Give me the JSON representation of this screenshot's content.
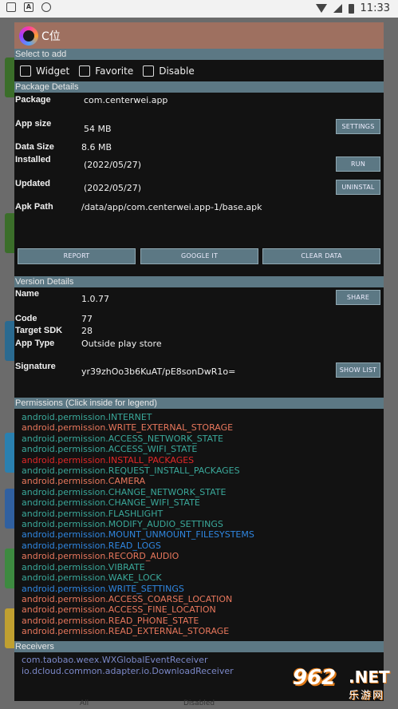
{
  "status_bar": {
    "time": "11:33"
  },
  "dialog": {
    "title": "C位"
  },
  "select_to_add": {
    "header": "Select to add",
    "options": [
      {
        "label": "Widget",
        "checked": false
      },
      {
        "label": "Favorite",
        "checked": false
      },
      {
        "label": "Disable",
        "checked": false
      }
    ]
  },
  "package_details": {
    "header": "Package Details",
    "package_label": "Package",
    "package_value": "com.centerwei.app",
    "app_size_label": "App size",
    "app_size_value": "54 MB",
    "data_size_label": "Data Size",
    "data_size_value": "8.6 MB",
    "installed_label": "Installed",
    "installed_value": "(2022/05/27)",
    "updated_label": "Updated",
    "updated_value": "(2022/05/27)",
    "apk_path_label": "Apk Path",
    "apk_path_value": "/data/app/com.centerwei.app-1/base.apk",
    "buttons": {
      "settings": "SETTINGS",
      "run": "RUN",
      "uninstal": "UNINSTAL",
      "report": "REPORT",
      "google_it": "GOOGLE IT",
      "clear_data": "CLEAR DATA"
    }
  },
  "version_details": {
    "header": "Version Details",
    "name_label": "Name",
    "name_value": "1.0.77",
    "code_label": "Code",
    "code_value": "77",
    "target_sdk_label": "Target SDK",
    "target_sdk_value": "28",
    "app_type_label": "App Type",
    "app_type_value": "Outside play store",
    "signature_label": "Signature",
    "signature_value": "yr39zhOo3b6KuAT/pE8sonDwR1o=",
    "buttons": {
      "share": "SHARE",
      "show_list": "SHOW LIST"
    }
  },
  "permissions": {
    "header": "Permissions (Click inside for legend)",
    "colors": {
      "teal": "#3aa89a",
      "salmon": "#e8775c",
      "red": "#e02828",
      "blue": "#2f86e0"
    },
    "items": [
      {
        "name": "android.permission.INTERNET",
        "color": "#3aa89a"
      },
      {
        "name": "android.permission.WRITE_EXTERNAL_STORAGE",
        "color": "#e8775c"
      },
      {
        "name": "android.permission.ACCESS_NETWORK_STATE",
        "color": "#3aa89a"
      },
      {
        "name": "android.permission.ACCESS_WIFI_STATE",
        "color": "#3aa89a"
      },
      {
        "name": "android.permission.INSTALL_PACKAGES",
        "color": "#e02828"
      },
      {
        "name": "android.permission.REQUEST_INSTALL_PACKAGES",
        "color": "#3aa89a"
      },
      {
        "name": "android.permission.CAMERA",
        "color": "#e8775c"
      },
      {
        "name": "android.permission.CHANGE_NETWORK_STATE",
        "color": "#3aa89a"
      },
      {
        "name": "android.permission.CHANGE_WIFI_STATE",
        "color": "#3aa89a"
      },
      {
        "name": "android.permission.FLASHLIGHT",
        "color": "#3aa89a"
      },
      {
        "name": "android.permission.MODIFY_AUDIO_SETTINGS",
        "color": "#3aa89a"
      },
      {
        "name": "android.permission.MOUNT_UNMOUNT_FILESYSTEMS",
        "color": "#2f86e0"
      },
      {
        "name": "android.permission.READ_LOGS",
        "color": "#2f86e0"
      },
      {
        "name": "android.permission.RECORD_AUDIO",
        "color": "#e8775c"
      },
      {
        "name": "android.permission.VIBRATE",
        "color": "#3aa89a"
      },
      {
        "name": "android.permission.WAKE_LOCK",
        "color": "#3aa89a"
      },
      {
        "name": "android.permission.WRITE_SETTINGS",
        "color": "#2f86e0"
      },
      {
        "name": "android.permission.ACCESS_COARSE_LOCATION",
        "color": "#e8775c"
      },
      {
        "name": "android.permission.ACCESS_FINE_LOCATION",
        "color": "#e8775c"
      },
      {
        "name": "android.permission.READ_PHONE_STATE",
        "color": "#e8775c"
      },
      {
        "name": "android.permission.READ_EXTERNAL_STORAGE",
        "color": "#e8775c"
      }
    ]
  },
  "receivers": {
    "header": "Receivers",
    "items": [
      "com.taobao.weex.WXGlobalEventReceiver",
      "io.dcloud.common.adapter.io.DownloadReceiver"
    ]
  },
  "watermark": {
    "number": "962",
    "suffix": ".NET",
    "chinese": "乐游网"
  },
  "background_tabs": {
    "all": "All",
    "disabled": "Disabled"
  }
}
